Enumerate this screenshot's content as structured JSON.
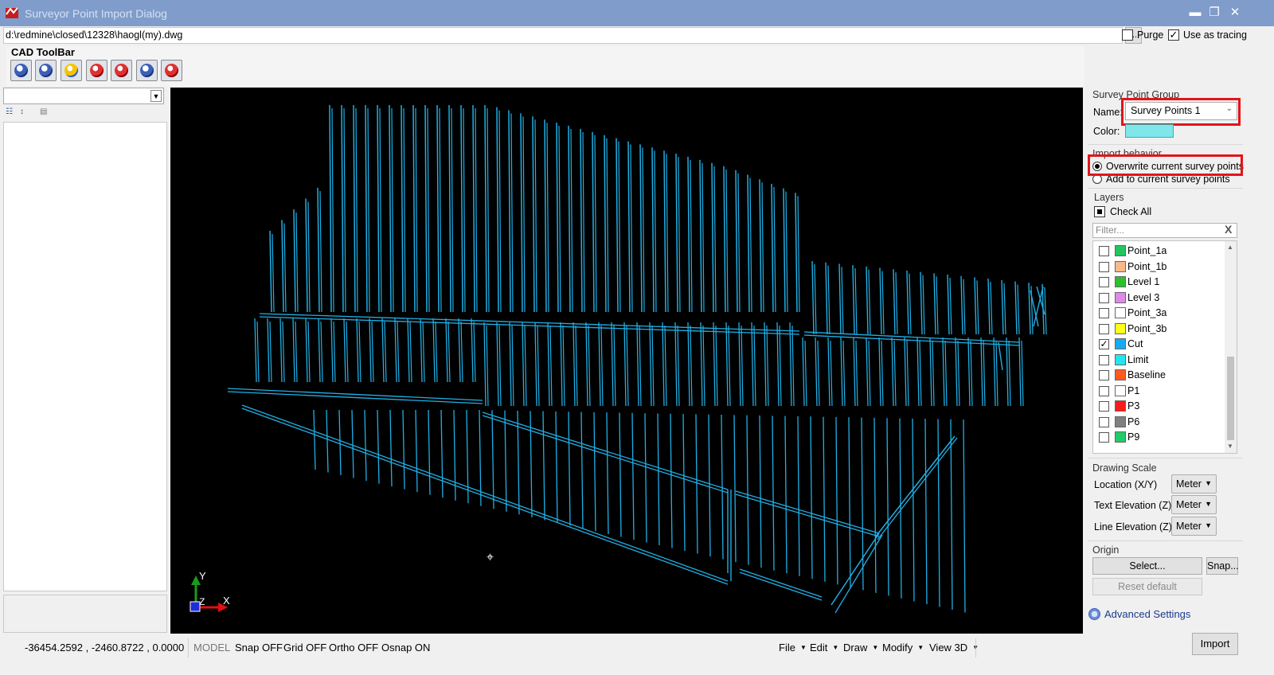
{
  "window": {
    "title": "Surveyor Point Import Dialog",
    "controls": {
      "minimize": "▬",
      "restore": "❐",
      "close": "✕"
    }
  },
  "file": {
    "path": "d:\\redmine\\closed\\12328\\haogl(my).dwg",
    "browse_label": "...",
    "purge_label": "Purge",
    "purge_checked": false,
    "tracing_label": "Use as tracing",
    "tracing_checked": true
  },
  "toolbar": {
    "title": "CAD ToolBar",
    "buttons": [
      "zoom-in-icon",
      "zoom-out-icon",
      "open-folder-icon",
      "zoom-extents-icon",
      "zoom-window-icon",
      "layer-icon",
      "delete-icon"
    ]
  },
  "left_panel": {
    "combo_value": "",
    "icons": [
      "categorized-icon",
      "alphabetical-icon",
      "property-pages-icon"
    ]
  },
  "canvas": {
    "background": "#000000",
    "line_color": "#1fb0e6",
    "axis_labels": {
      "y": "Y",
      "z": "Z",
      "x": "X"
    }
  },
  "survey_group": {
    "title": "Survey Point Group",
    "name_label": "Name:",
    "name_value": "Survey Points 1",
    "color_label": "Color:",
    "color_value": "#7fe6e9"
  },
  "import_behavior": {
    "title": "Import behavior",
    "options": [
      {
        "label": "Overwrite current survey points",
        "selected": true
      },
      {
        "label": "Add to current survey points",
        "selected": false
      }
    ]
  },
  "layers": {
    "title": "Layers",
    "check_all_label": "Check All",
    "filter_placeholder": "Filter...",
    "filter_clear": "X",
    "items": [
      {
        "name": "Point_1a",
        "color": "#22c55e",
        "checked": false
      },
      {
        "name": "Point_1b",
        "color": "#f9b98a",
        "checked": false
      },
      {
        "name": "Level 1",
        "color": "#2dbf2d",
        "checked": false
      },
      {
        "name": "Level 3",
        "color": "#e08ae8",
        "checked": false
      },
      {
        "name": "Point_3a",
        "color": "#ffffff",
        "checked": false
      },
      {
        "name": "Point_3b",
        "color": "#ffff1a",
        "checked": false
      },
      {
        "name": "Cut",
        "color": "#1aa9f0",
        "checked": true
      },
      {
        "name": "Limit",
        "color": "#22e6ee",
        "checked": false
      },
      {
        "name": "Baseline",
        "color": "#ff5a1f",
        "checked": false
      },
      {
        "name": "P1",
        "color": "#ffffff",
        "checked": false
      },
      {
        "name": "P3",
        "color": "#ff1a1a",
        "checked": false
      },
      {
        "name": "P6",
        "color": "#808080",
        "checked": false
      },
      {
        "name": "P9",
        "color": "#1fcc66",
        "checked": false
      }
    ]
  },
  "drawing_scale": {
    "title": "Drawing Scale",
    "rows": [
      {
        "label": "Location (X/Y)",
        "value": "Meter"
      },
      {
        "label": "Text Elevation (Z)",
        "value": "Meter"
      },
      {
        "label": "Line Elevation (Z)",
        "value": "Meter"
      }
    ]
  },
  "origin": {
    "title": "Origin",
    "select_label": "Select...",
    "snap_label": "Snap...",
    "reset_label": "Reset default"
  },
  "advanced_label": "Advanced Settings",
  "import_label": "Import",
  "status": {
    "coords": "-36454.2592 , -2460.8722 , 0.0000",
    "model": "MODEL",
    "snap": "Snap OFF",
    "grid": "Grid OFF",
    "ortho": "Ortho OFF",
    "osnap": "Osnap ON",
    "menus": [
      "File",
      "Edit",
      "Draw",
      "Modify",
      "View 3D"
    ]
  }
}
